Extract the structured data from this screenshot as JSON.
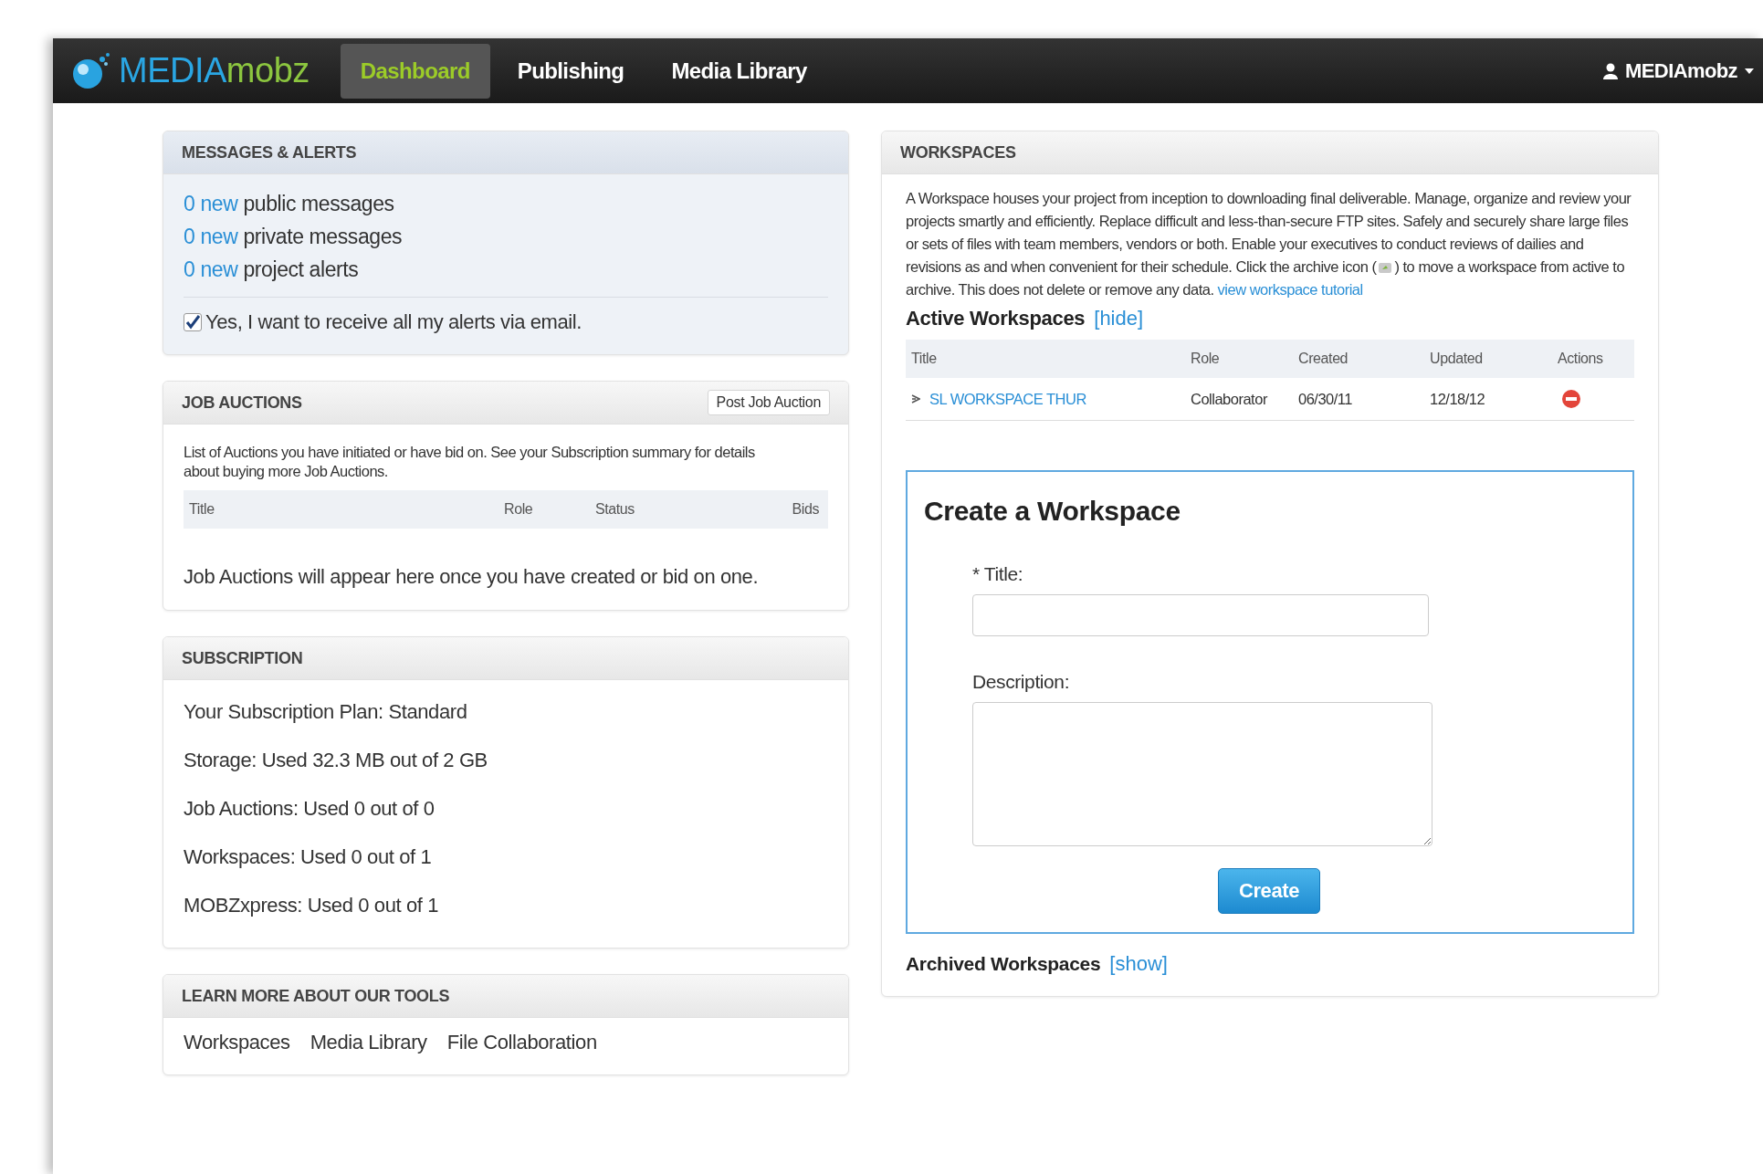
{
  "navbar": {
    "logo": {
      "first": "MEDIA",
      "second": "mobz"
    },
    "items": [
      {
        "label": "Dashboard",
        "selected": true
      },
      {
        "label": "Publishing",
        "selected": false
      },
      {
        "label": "Media Library",
        "selected": false
      }
    ],
    "user": "MEDIAmobz"
  },
  "messages": {
    "title": "MESSAGES & ALERTS",
    "items": [
      {
        "count": "0",
        "link": "new",
        "text": "public messages"
      },
      {
        "count": "0",
        "link": "new",
        "text": "private messages"
      },
      {
        "count": "0",
        "link": "new",
        "text": "project alerts"
      }
    ],
    "email_alerts": {
      "label": "Yes, I want to receive all my alerts via email.",
      "checked": true
    }
  },
  "job_auctions": {
    "title": "JOB AUCTIONS",
    "button": "Post Job Auction",
    "description": "List of Auctions you have initiated or have bid on. See your Subscription summary for details about buying more Job Auctions.",
    "columns": [
      "Title",
      "Role",
      "Status",
      "Bids"
    ],
    "empty": "Job Auctions will appear here once you have created or bid on one."
  },
  "subscription": {
    "title": "SUBSCRIPTION",
    "lines": [
      "Your Subscription Plan: Standard",
      "Storage: Used 32.3 MB out of 2 GB",
      "Job Auctions: Used 0 out of 0",
      "Workspaces: Used 0 out of 1",
      "MOBZxpress: Used 0 out of 1"
    ]
  },
  "learn_more": {
    "title": "LEARN MORE ABOUT OUR TOOLS",
    "links": [
      "Workspaces",
      "Media Library",
      "File Collaboration"
    ]
  },
  "workspaces": {
    "title": "WORKSPACES",
    "description_before": "A Workspace houses your project from inception to downloading final deliverable. Manage, organize and review your projects smartly and efficiently. Replace difficult and less-than-secure FTP sites. Safely and securely share large files or sets of files with team members, vendors or both. Enable your executives to conduct reviews of dailies and revisions as and when convenient for their schedule. Click the archive icon (",
    "description_after": ") to move a workspace from active to archive. This does not delete or remove any data.",
    "tutorial_link": "view workspace tutorial",
    "active": {
      "heading": "Active Workspaces",
      "toggle": "[hide]",
      "columns": [
        "Title",
        "Role",
        "Created",
        "Updated",
        "Actions"
      ],
      "rows": [
        {
          "title": "SL WORKSPACE THUR",
          "role": "Collaborator",
          "created": "06/30/11",
          "updated": "12/18/12"
        }
      ]
    },
    "create": {
      "heading": "Create a Workspace",
      "title_label": "* Title:",
      "description_label": "Description:",
      "button": "Create"
    },
    "archived": {
      "heading": "Archived Workspaces",
      "toggle": "[show]"
    }
  }
}
